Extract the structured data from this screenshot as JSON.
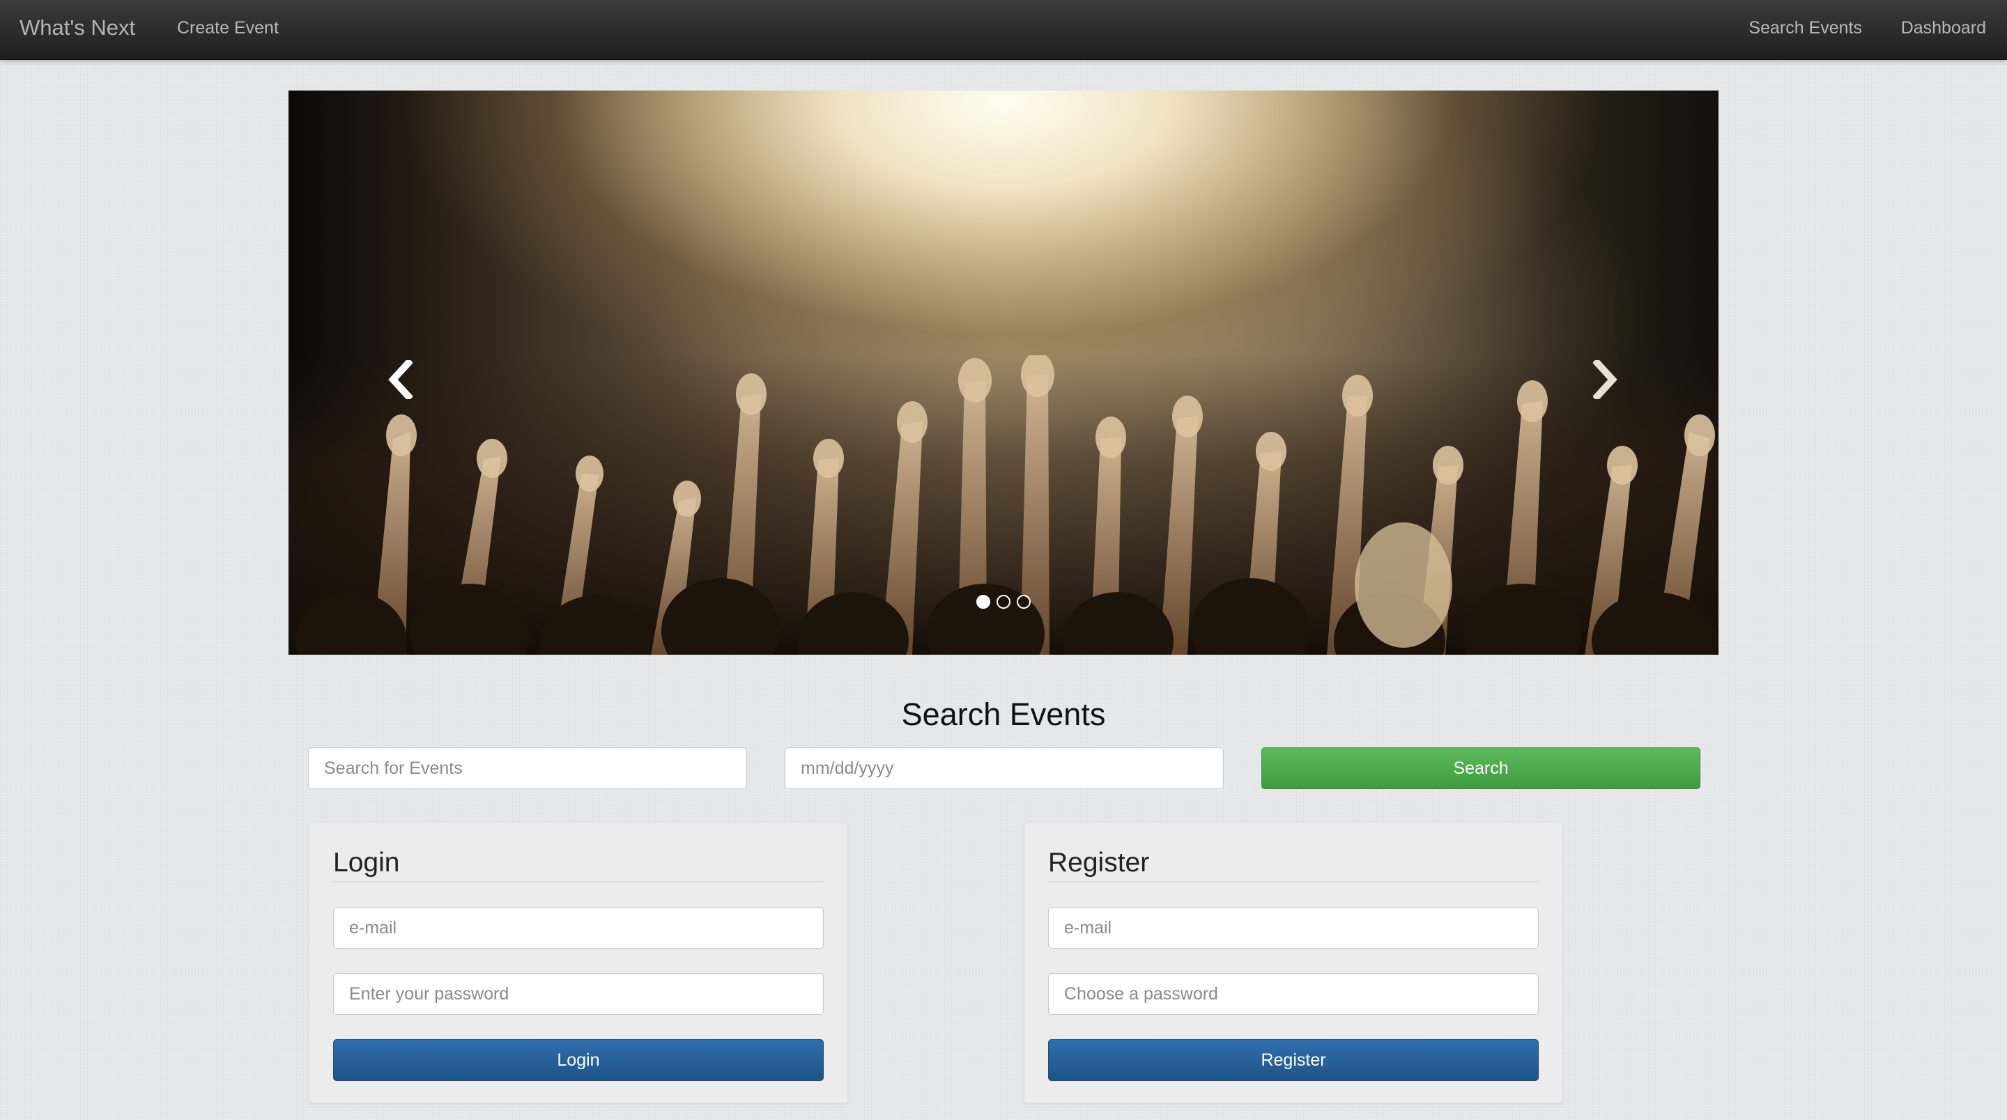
{
  "navbar": {
    "brand": "What's Next",
    "create_event": "Create Event",
    "search_events": "Search Events",
    "dashboard": "Dashboard"
  },
  "carousel": {
    "slide_count": 3,
    "active_index": 0
  },
  "search": {
    "title": "Search Events",
    "query_placeholder": "Search for Events",
    "date_placeholder": "mm/dd/yyyy",
    "button_label": "Search",
    "button_color": "#4cae4c"
  },
  "login": {
    "title": "Login",
    "email_placeholder": "e-mail",
    "password_placeholder": "Enter your password",
    "button_label": "Login",
    "button_color": "#2a649f"
  },
  "register": {
    "title": "Register",
    "email_placeholder": "e-mail",
    "password_placeholder": "Choose a password",
    "button_label": "Register",
    "button_color": "#2a649f"
  }
}
